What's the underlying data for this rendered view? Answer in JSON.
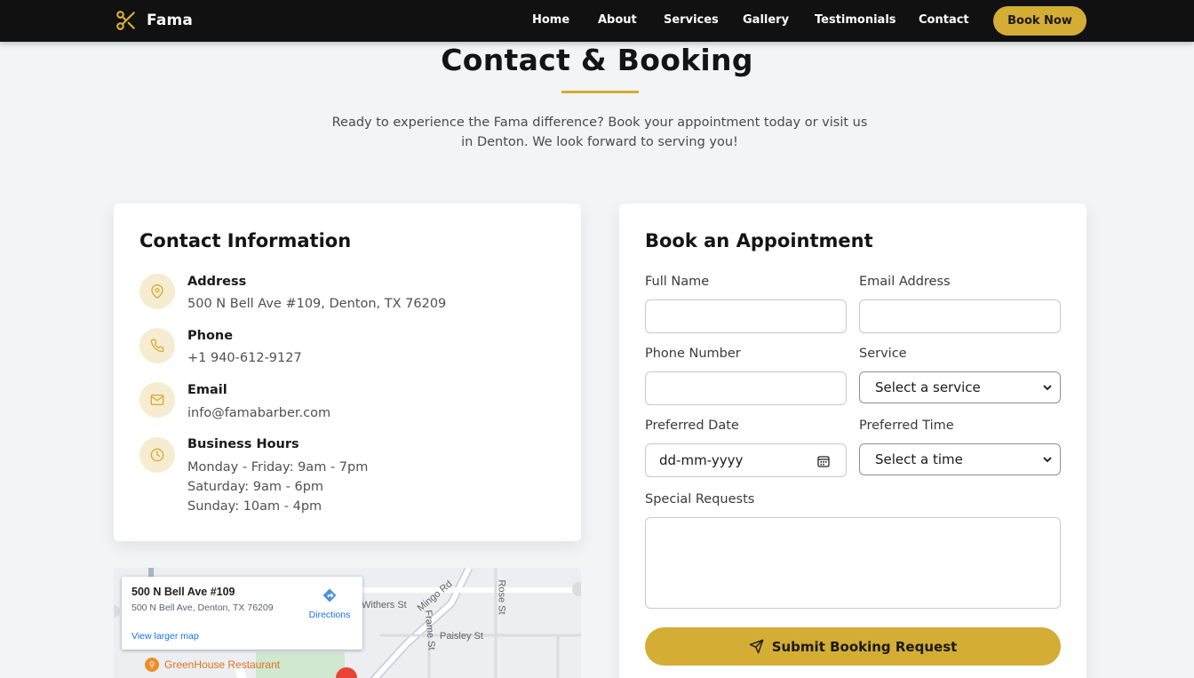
{
  "nav": {
    "brand": "Fama",
    "links": [
      "Home",
      "About",
      "Services",
      "Gallery",
      "Testimonials",
      "Contact"
    ],
    "cta": "Book Now"
  },
  "header": {
    "title": "Contact & Booking",
    "intro": "Ready to experience the Fama difference? Book your appointment today or visit us in Denton. We look forward to serving you!"
  },
  "contact": {
    "title": "Contact Information",
    "items": [
      {
        "icon": "map-pin-icon",
        "label": "Address",
        "lines": [
          "500 N Bell Ave #109, Denton, TX 76209"
        ]
      },
      {
        "icon": "phone-icon",
        "label": "Phone",
        "lines": [
          "+1 940-612-9127"
        ]
      },
      {
        "icon": "mail-icon",
        "label": "Email",
        "lines": [
          "info@famabarber.com"
        ]
      },
      {
        "icon": "clock-icon",
        "label": "Business Hours",
        "lines": [
          "Monday - Friday: 9am - 7pm",
          "Saturday: 9am - 6pm",
          "Sunday: 10am - 4pm"
        ]
      }
    ]
  },
  "map": {
    "popup_title": "500 N Bell Ave #109",
    "popup_address": "500 N Bell Ave, Denton, TX 76209",
    "directions": "Directions",
    "larger_map": "View larger map",
    "poi": "GreenHouse Restaurant",
    "streets": [
      "Withers St",
      "Mingo Rd",
      "Frame St",
      "Paisley St",
      "Rose St"
    ]
  },
  "booking": {
    "title": "Book an Appointment",
    "full_name_label": "Full Name",
    "email_label": "Email Address",
    "phone_label": "Phone Number",
    "service_label": "Service",
    "service_value": "Select a service",
    "date_label": "Preferred Date",
    "date_placeholder": "dd-mm-yyyy",
    "time_label": "Preferred Time",
    "time_value": "Select a time",
    "requests_label": "Special Requests",
    "submit": "Submit Booking Request"
  },
  "colors": {
    "accent": "#d4ad34",
    "nav_bg": "#111111",
    "page_bg": "#f3f4f6",
    "icon_bg": "#f6ecd1"
  }
}
